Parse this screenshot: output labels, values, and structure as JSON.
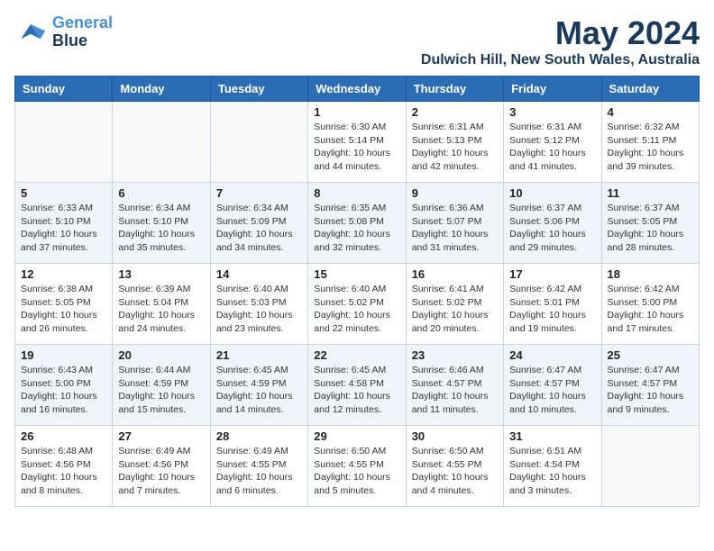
{
  "logo": {
    "line1": "General",
    "line2": "Blue"
  },
  "title": "May 2024",
  "subtitle": "Dulwich Hill, New South Wales, Australia",
  "days_header": [
    "Sunday",
    "Monday",
    "Tuesday",
    "Wednesday",
    "Thursday",
    "Friday",
    "Saturday"
  ],
  "weeks": [
    [
      {
        "day": "",
        "info": ""
      },
      {
        "day": "",
        "info": ""
      },
      {
        "day": "",
        "info": ""
      },
      {
        "day": "1",
        "info": "Sunrise: 6:30 AM\nSunset: 5:14 PM\nDaylight: 10 hours\nand 44 minutes."
      },
      {
        "day": "2",
        "info": "Sunrise: 6:31 AM\nSunset: 5:13 PM\nDaylight: 10 hours\nand 42 minutes."
      },
      {
        "day": "3",
        "info": "Sunrise: 6:31 AM\nSunset: 5:12 PM\nDaylight: 10 hours\nand 41 minutes."
      },
      {
        "day": "4",
        "info": "Sunrise: 6:32 AM\nSunset: 5:11 PM\nDaylight: 10 hours\nand 39 minutes."
      }
    ],
    [
      {
        "day": "5",
        "info": "Sunrise: 6:33 AM\nSunset: 5:10 PM\nDaylight: 10 hours\nand 37 minutes."
      },
      {
        "day": "6",
        "info": "Sunrise: 6:34 AM\nSunset: 5:10 PM\nDaylight: 10 hours\nand 35 minutes."
      },
      {
        "day": "7",
        "info": "Sunrise: 6:34 AM\nSunset: 5:09 PM\nDaylight: 10 hours\nand 34 minutes."
      },
      {
        "day": "8",
        "info": "Sunrise: 6:35 AM\nSunset: 5:08 PM\nDaylight: 10 hours\nand 32 minutes."
      },
      {
        "day": "9",
        "info": "Sunrise: 6:36 AM\nSunset: 5:07 PM\nDaylight: 10 hours\nand 31 minutes."
      },
      {
        "day": "10",
        "info": "Sunrise: 6:37 AM\nSunset: 5:06 PM\nDaylight: 10 hours\nand 29 minutes."
      },
      {
        "day": "11",
        "info": "Sunrise: 6:37 AM\nSunset: 5:05 PM\nDaylight: 10 hours\nand 28 minutes."
      }
    ],
    [
      {
        "day": "12",
        "info": "Sunrise: 6:38 AM\nSunset: 5:05 PM\nDaylight: 10 hours\nand 26 minutes."
      },
      {
        "day": "13",
        "info": "Sunrise: 6:39 AM\nSunset: 5:04 PM\nDaylight: 10 hours\nand 24 minutes."
      },
      {
        "day": "14",
        "info": "Sunrise: 6:40 AM\nSunset: 5:03 PM\nDaylight: 10 hours\nand 23 minutes."
      },
      {
        "day": "15",
        "info": "Sunrise: 6:40 AM\nSunset: 5:02 PM\nDaylight: 10 hours\nand 22 minutes."
      },
      {
        "day": "16",
        "info": "Sunrise: 6:41 AM\nSunset: 5:02 PM\nDaylight: 10 hours\nand 20 minutes."
      },
      {
        "day": "17",
        "info": "Sunrise: 6:42 AM\nSunset: 5:01 PM\nDaylight: 10 hours\nand 19 minutes."
      },
      {
        "day": "18",
        "info": "Sunrise: 6:42 AM\nSunset: 5:00 PM\nDaylight: 10 hours\nand 17 minutes."
      }
    ],
    [
      {
        "day": "19",
        "info": "Sunrise: 6:43 AM\nSunset: 5:00 PM\nDaylight: 10 hours\nand 16 minutes."
      },
      {
        "day": "20",
        "info": "Sunrise: 6:44 AM\nSunset: 4:59 PM\nDaylight: 10 hours\nand 15 minutes."
      },
      {
        "day": "21",
        "info": "Sunrise: 6:45 AM\nSunset: 4:59 PM\nDaylight: 10 hours\nand 14 minutes."
      },
      {
        "day": "22",
        "info": "Sunrise: 6:45 AM\nSunset: 4:58 PM\nDaylight: 10 hours\nand 12 minutes."
      },
      {
        "day": "23",
        "info": "Sunrise: 6:46 AM\nSunset: 4:57 PM\nDaylight: 10 hours\nand 11 minutes."
      },
      {
        "day": "24",
        "info": "Sunrise: 6:47 AM\nSunset: 4:57 PM\nDaylight: 10 hours\nand 10 minutes."
      },
      {
        "day": "25",
        "info": "Sunrise: 6:47 AM\nSunset: 4:57 PM\nDaylight: 10 hours\nand 9 minutes."
      }
    ],
    [
      {
        "day": "26",
        "info": "Sunrise: 6:48 AM\nSunset: 4:56 PM\nDaylight: 10 hours\nand 8 minutes."
      },
      {
        "day": "27",
        "info": "Sunrise: 6:49 AM\nSunset: 4:56 PM\nDaylight: 10 hours\nand 7 minutes."
      },
      {
        "day": "28",
        "info": "Sunrise: 6:49 AM\nSunset: 4:55 PM\nDaylight: 10 hours\nand 6 minutes."
      },
      {
        "day": "29",
        "info": "Sunrise: 6:50 AM\nSunset: 4:55 PM\nDaylight: 10 hours\nand 5 minutes."
      },
      {
        "day": "30",
        "info": "Sunrise: 6:50 AM\nSunset: 4:55 PM\nDaylight: 10 hours\nand 4 minutes."
      },
      {
        "day": "31",
        "info": "Sunrise: 6:51 AM\nSunset: 4:54 PM\nDaylight: 10 hours\nand 3 minutes."
      },
      {
        "day": "",
        "info": ""
      }
    ]
  ]
}
